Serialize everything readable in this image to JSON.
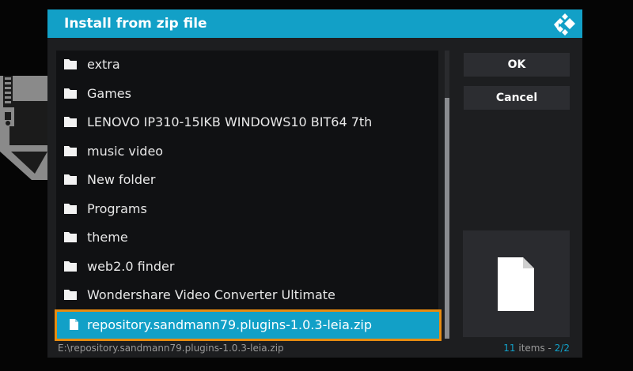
{
  "dialog": {
    "title": "Install from zip file",
    "logo_icon": "kodi-logo-icon"
  },
  "file_list": {
    "items": [
      {
        "label": "extra",
        "icon": "folder-icon",
        "type": "folder"
      },
      {
        "label": "Games",
        "icon": "folder-icon",
        "type": "folder"
      },
      {
        "label": "LENOVO IP310-15IKB WINDOWS10 BIT64 7th",
        "icon": "folder-icon",
        "type": "folder"
      },
      {
        "label": "music video",
        "icon": "folder-icon",
        "type": "folder"
      },
      {
        "label": "New folder",
        "icon": "folder-icon",
        "type": "folder"
      },
      {
        "label": "Programs",
        "icon": "folder-icon",
        "type": "folder"
      },
      {
        "label": "theme",
        "icon": "folder-icon",
        "type": "folder"
      },
      {
        "label": "web2.0 finder",
        "icon": "folder-icon",
        "type": "folder"
      },
      {
        "label": "Wondershare Video Converter Ultimate",
        "icon": "folder-icon",
        "type": "folder"
      },
      {
        "label": "repository.sandmann79.plugins-1.0.3-leia.zip",
        "icon": "file-icon",
        "type": "file",
        "selected": true
      }
    ]
  },
  "buttons": {
    "ok_label": "OK",
    "cancel_label": "Cancel"
  },
  "preview": {
    "icon": "file-icon"
  },
  "footer": {
    "path": "E:\\repository.sandmann79.plugins-1.0.3-leia.zip",
    "item_count": "11",
    "items_word": " items - ",
    "page": "2/2"
  },
  "colors": {
    "accent": "#12a0c7",
    "focus_outline": "#e88b10",
    "dialog_bg": "#1d1e20",
    "list_bg": "#101113"
  }
}
